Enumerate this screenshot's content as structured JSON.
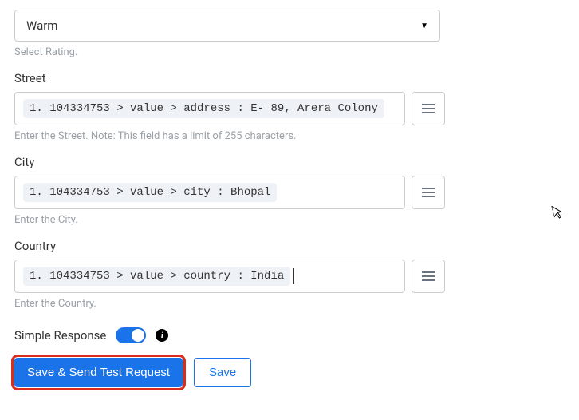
{
  "rating": {
    "value": "Warm",
    "helper": "Select Rating."
  },
  "street": {
    "label": "Street",
    "tag": "1. 104334753 > value > address : E- 89, Arera Colony",
    "helper": "Enter the Street. Note: This field has a limit of 255 characters."
  },
  "city": {
    "label": "City",
    "tag": "1. 104334753 > value > city : Bhopal",
    "helper": "Enter the City."
  },
  "country": {
    "label": "Country",
    "tag": "1. 104334753 > value > country : India",
    "helper": "Enter the Country."
  },
  "simple_response": {
    "label": "Simple Response",
    "info": "i"
  },
  "buttons": {
    "primary": "Save & Send Test Request",
    "secondary": "Save"
  }
}
